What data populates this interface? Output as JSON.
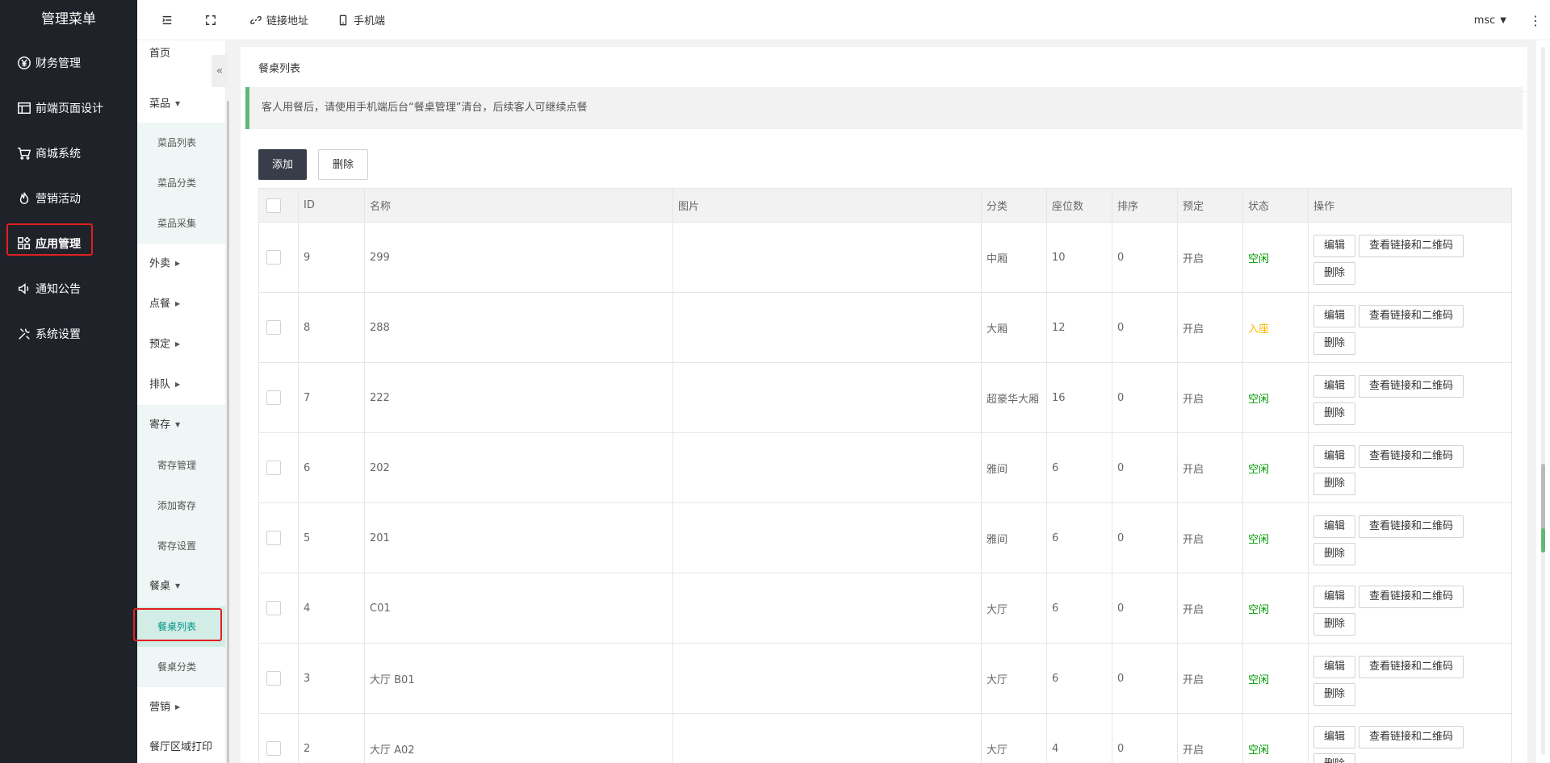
{
  "sidebar": {
    "title": "管理菜单",
    "items": [
      {
        "label": "财务管理",
        "icon": "yen-icon"
      },
      {
        "label": "前端页面设计",
        "icon": "layout-icon"
      },
      {
        "label": "商城系统",
        "icon": "cart-icon"
      },
      {
        "label": "营销活动",
        "icon": "fire-icon"
      },
      {
        "label": "应用管理",
        "icon": "apps-icon"
      },
      {
        "label": "通知公告",
        "icon": "speaker-icon"
      },
      {
        "label": "系统设置",
        "icon": "tools-icon"
      }
    ]
  },
  "submenu": {
    "home": "首页",
    "dishes": {
      "label": "菜品",
      "children": [
        "菜品列表",
        "菜品分类",
        "菜品采集"
      ]
    },
    "takeout": "外卖",
    "order": "点餐",
    "reserve": "预定",
    "queue": "排队",
    "storage": {
      "label": "寄存",
      "children": [
        "寄存管理",
        "添加寄存",
        "寄存设置"
      ]
    },
    "tables": {
      "label": "餐桌",
      "children": [
        "餐桌列表",
        "餐桌分类"
      ]
    },
    "marketing": "营销",
    "print": "餐厅区域打印",
    "collapse": "«"
  },
  "header": {
    "link_label": "链接地址",
    "mobile_label": "手机端",
    "user": "msc",
    "more": "⋮"
  },
  "page": {
    "title": "餐桌列表",
    "notice": "客人用餐后，请使用手机端后台“餐桌管理”清台，后续客人可继续点餐",
    "add_label": "添加",
    "delete_label": "删除"
  },
  "table": {
    "columns": [
      "ID",
      "名称",
      "图片",
      "分类",
      "座位数",
      "排序",
      "预定",
      "状态",
      "操作"
    ],
    "op_labels": {
      "edit": "编辑",
      "view": "查看链接和二维码",
      "delete": "删除"
    },
    "rows": [
      {
        "id": "9",
        "name": "299",
        "category": "中厢",
        "seats": "10",
        "sort": "0",
        "reserve": "开启",
        "status": "空闲",
        "status_color": "#009900"
      },
      {
        "id": "8",
        "name": "288",
        "category": "大厢",
        "seats": "12",
        "sort": "0",
        "reserve": "开启",
        "status": "入座",
        "status_color": "#ffb800"
      },
      {
        "id": "7",
        "name": "222",
        "category": "超豪华大厢",
        "seats": "16",
        "sort": "0",
        "reserve": "开启",
        "status": "空闲",
        "status_color": "#009900"
      },
      {
        "id": "6",
        "name": "202",
        "category": "雅间",
        "seats": "6",
        "sort": "0",
        "reserve": "开启",
        "status": "空闲",
        "status_color": "#009900"
      },
      {
        "id": "5",
        "name": "201",
        "category": "雅间",
        "seats": "6",
        "sort": "0",
        "reserve": "开启",
        "status": "空闲",
        "status_color": "#009900"
      },
      {
        "id": "4",
        "name": "C01",
        "category": "大厅",
        "seats": "6",
        "sort": "0",
        "reserve": "开启",
        "status": "空闲",
        "status_color": "#009900"
      },
      {
        "id": "3",
        "name": "大厅 B01",
        "category": "大厅",
        "seats": "6",
        "sort": "0",
        "reserve": "开启",
        "status": "空闲",
        "status_color": "#009900"
      },
      {
        "id": "2",
        "name": "大厅 A02",
        "category": "大厅",
        "seats": "4",
        "sort": "0",
        "reserve": "开启",
        "status": "空闲",
        "status_color": "#009900"
      }
    ]
  }
}
